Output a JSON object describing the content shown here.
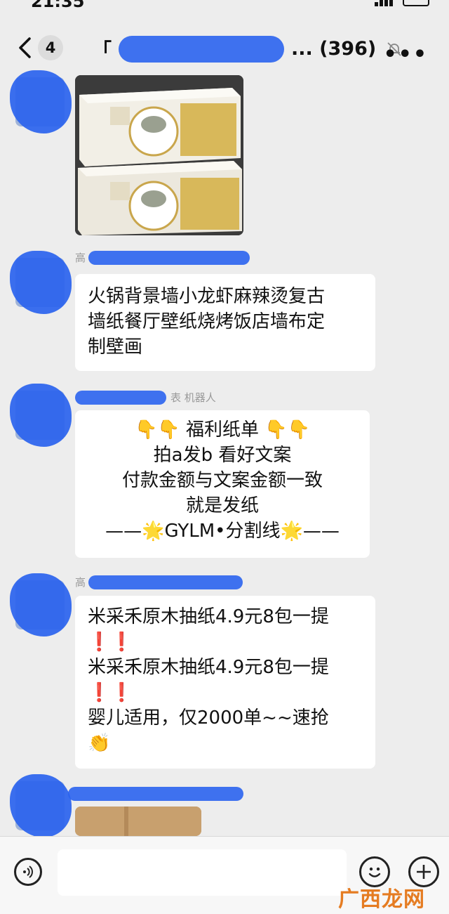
{
  "status": {
    "time": "21:35"
  },
  "header": {
    "back_count": "4",
    "title_prefix": "「",
    "title_suffix": "... (396)",
    "more": "•••"
  },
  "messages": [
    {
      "type": "image"
    },
    {
      "type": "text",
      "name_visible": "高",
      "lines": [
        "火锅背景墙小龙虾麻辣烫复古",
        "墙纸餐厅壁纸烧烤饭店墙布定",
        "制壁画"
      ]
    },
    {
      "type": "text",
      "name_visible": "表 机器人",
      "lines": [
        "👇👇  福利纸单  👇👇",
        "拍a发b   看好文案",
        "付款金额与文案金额一致",
        "就是发纸",
        "——🌟GYLM•分割线🌟——"
      ]
    },
    {
      "type": "text",
      "name_visible": "高",
      "lines": [
        "米采禾原木抽纸4.9元8包一提",
        "❗️❗️",
        "米采禾原木抽纸4.9元8包一提",
        "❗️❗️",
        "婴儿适用，仅2000单~~速抢",
        "👏"
      ]
    },
    {
      "type": "image"
    }
  ],
  "input_bar": {
    "placeholder": ""
  },
  "watermark": "广西龙网",
  "colors": {
    "background": "#ededed",
    "bubble": "#ffffff",
    "redaction": "#2a63ee"
  }
}
